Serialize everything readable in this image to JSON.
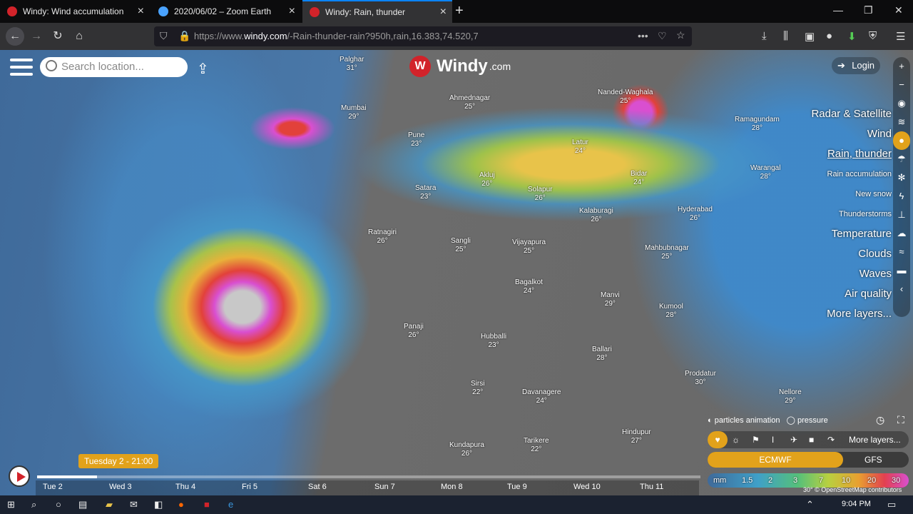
{
  "tabs": [
    {
      "title": "Windy: Wind accumulation",
      "fav": "#d2232a"
    },
    {
      "title": "2020/06/02 – Zoom Earth",
      "fav": "#4aa3ff"
    },
    {
      "title": "Windy: Rain, thunder",
      "fav": "#d2232a"
    }
  ],
  "url": {
    "prefix": "https://www.",
    "host": "windy.com",
    "path": "/-Rain-thunder-rain?950h,rain,16.383,74.520,7"
  },
  "app": {
    "brand": "Windy",
    "domain": ".com",
    "search_placeholder": "Search location...",
    "login": "Login"
  },
  "cities": [
    {
      "name": "Palghar",
      "temp": "31°"
    },
    {
      "name": "Mumbai",
      "temp": "29°"
    },
    {
      "name": "Ahmednagar",
      "temp": "25°"
    },
    {
      "name": "Pune",
      "temp": "23°"
    },
    {
      "name": "Satara",
      "temp": "23°"
    },
    {
      "name": "Akluj",
      "temp": "26°"
    },
    {
      "name": "Solapur",
      "temp": "26°"
    },
    {
      "name": "Latur",
      "temp": "24°"
    },
    {
      "name": "Nanded-Waghala",
      "temp": "25°"
    },
    {
      "name": "Ratnagiri",
      "temp": "26°"
    },
    {
      "name": "Sangli",
      "temp": "25°"
    },
    {
      "name": "Vijayapura",
      "temp": "25°"
    },
    {
      "name": "Bagalkot",
      "temp": "24°"
    },
    {
      "name": "Manvi",
      "temp": "29°"
    },
    {
      "name": "Kumool",
      "temp": "28°"
    },
    {
      "name": "Panaji",
      "temp": "26°"
    },
    {
      "name": "Hubballi",
      "temp": "23°"
    },
    {
      "name": "Ballari",
      "temp": "28°"
    },
    {
      "name": "Sirsi",
      "temp": "22°"
    },
    {
      "name": "Davanagere",
      "temp": "24°"
    },
    {
      "name": "Proddatur",
      "temp": "30°"
    },
    {
      "name": "Kundapura",
      "temp": "26°"
    },
    {
      "name": "Tarikere",
      "temp": "22°"
    },
    {
      "name": "Hindupur",
      "temp": "27°"
    },
    {
      "name": "Hyderabad",
      "temp": "26°"
    },
    {
      "name": "Mahbubnagar",
      "temp": "25°"
    },
    {
      "name": "Ramagundam",
      "temp": "28°"
    },
    {
      "name": "Warangal",
      "temp": "28°"
    },
    {
      "name": "Kalaburagi",
      "temp": "26°"
    },
    {
      "name": "Bidar",
      "temp": "24°"
    },
    {
      "name": "Nellore",
      "temp": "29°"
    }
  ],
  "layers": [
    "Radar & Satellite",
    "Wind",
    "Rain, thunder",
    "Rain accumulation",
    "New snow",
    "Thunderstorms",
    "Temperature",
    "Clouds",
    "Waves",
    "Air quality",
    "More layers..."
  ],
  "options": {
    "particles": "particles animation",
    "pressure": "pressure",
    "more": "More layers..."
  },
  "models": {
    "primary": "ECMWF",
    "secondary": "GFS"
  },
  "legend": {
    "unit": "mm",
    "values": [
      "1.5",
      "2",
      "3",
      "7",
      "10",
      "20",
      "30"
    ]
  },
  "attribution": "30° © OpenStreetMap contributors",
  "timeline": {
    "current": "Tuesday 2 - 21:00",
    "progress": 0.09,
    "days": [
      "Tue 2",
      "Wed 3",
      "Thu 4",
      "Fri 5",
      "Sat 6",
      "Sun 7",
      "Mon 8",
      "Tue 9",
      "Wed 10",
      "Thu 11"
    ]
  },
  "taskbar": {
    "time": "9:04 PM"
  }
}
